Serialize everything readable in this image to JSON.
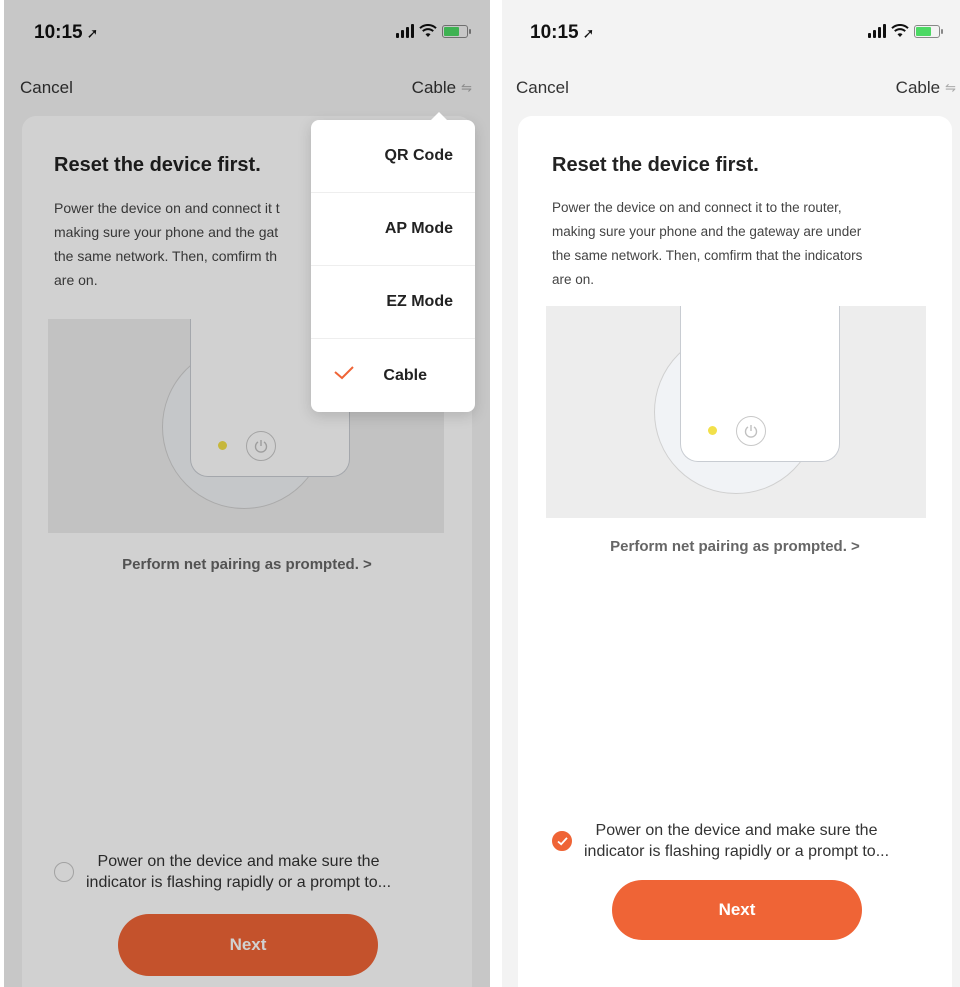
{
  "status": {
    "time": "10:15"
  },
  "nav": {
    "cancel_label": "Cancel",
    "mode_label": "Cable"
  },
  "card": {
    "title": "Reset the device first.",
    "description": "Power the device on and connect it to the router, making sure your phone and the gateway are under the same network. Then, comfirm that the indicators are on.",
    "description_left_lines": [
      "Power the device on and connect it t",
      "making sure your phone and the gat",
      "the same network. Then, comfirm th",
      "are on."
    ],
    "description_right_lines": [
      "Power the device on and connect it to the router,",
      "making sure your phone and the gateway are under",
      "the same network. Then, comfirm that the indicators",
      "are on."
    ],
    "prompt_link": "Perform net pairing as prompted. >",
    "agree_line1": "Power on the device and make sure the",
    "agree_line2": "indicator is flashing rapidly or a prompt to...",
    "next_label": "Next"
  },
  "dropdown": {
    "items": [
      {
        "label": "QR Code",
        "selected": false
      },
      {
        "label": "AP Mode",
        "selected": false
      },
      {
        "label": "EZ Mode",
        "selected": false
      },
      {
        "label": "Cable",
        "selected": true
      }
    ]
  },
  "colors": {
    "accent": "#ef6436",
    "led": "#f2e04a",
    "background": "#f3f3f3"
  }
}
